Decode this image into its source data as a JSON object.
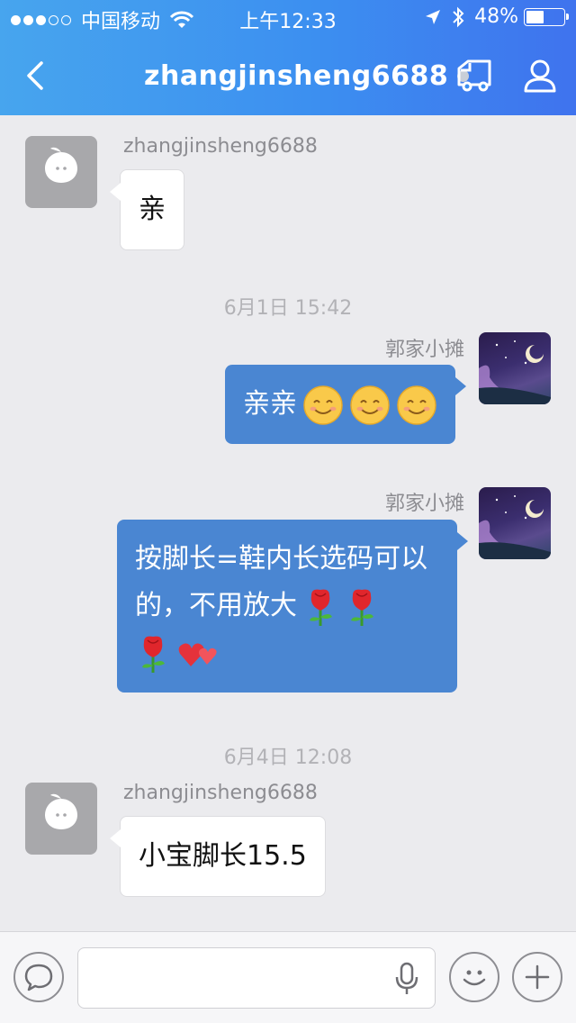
{
  "status_bar": {
    "carrier": "中国移动",
    "time": "上午12:33",
    "battery": "48%",
    "battery_level": 0.48,
    "signal_bars_filled": 3,
    "signal_bars_total": 5
  },
  "header": {
    "back_icon": "chevron-left-icon",
    "title": "zhangjinsheng6688",
    "status_dot_color": "#c9cfd8",
    "truck_icon": "truck-icon",
    "profile_icon": "user-icon",
    "gradient_start": "#47a5ee",
    "gradient_end": "#3f73ee"
  },
  "messages": [
    {
      "type": "incoming",
      "sender": "zhangjinsheng6688",
      "text": "亲"
    },
    {
      "type": "timestamp",
      "text": "6月1日 15:42"
    },
    {
      "type": "outgoing",
      "sender": "郭家小摊",
      "text": "亲亲",
      "emoji": [
        "smile-emoji",
        "smile-emoji",
        "smile-emoji"
      ]
    },
    {
      "type": "outgoing",
      "sender": "郭家小摊",
      "line1": "按脚长=鞋内长选码可以",
      "line2": "的，不用放大",
      "emoji": [
        "rose-emoji",
        "rose-emoji",
        "rose-emoji",
        "hearts-emoji"
      ]
    },
    {
      "type": "timestamp",
      "text": "6月4日 12:08"
    },
    {
      "type": "incoming",
      "sender": "zhangjinsheng6688",
      "text": "小宝脚长15.5"
    }
  ],
  "input_bar": {
    "voice_icon": "chat-bubble-icon",
    "input_value": "",
    "mic_icon": "microphone-icon",
    "emoji_icon": "smiley-icon",
    "plus_icon": "plus-icon"
  },
  "colors": {
    "outgoing_bubble": "#4a86d2",
    "incoming_bubble": "#ffffff",
    "chat_background": "#ebebee"
  }
}
